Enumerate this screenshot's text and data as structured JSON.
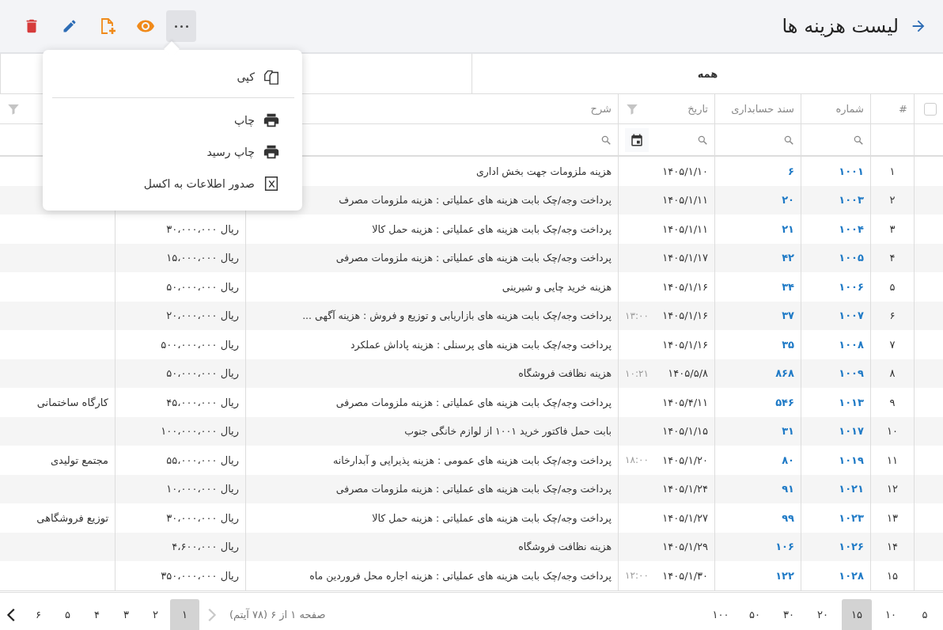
{
  "header": {
    "title": "لیست هزینه ها"
  },
  "toolbar": {
    "more_button": {
      "expanded": true
    }
  },
  "menu": {
    "items": [
      {
        "kind": "copy",
        "label": "کپی"
      },
      {
        "kind": "divider"
      },
      {
        "kind": "print",
        "label": "چاپ"
      },
      {
        "kind": "print",
        "label": "چاپ رسید"
      },
      {
        "kind": "excel",
        "label": "صدور اطلاعات به اکسل"
      }
    ]
  },
  "tabs": [
    {
      "label": "همه",
      "selected": true
    },
    {
      "selected": false
    }
  ],
  "table": {
    "columns": [
      {
        "kind": "checkbox",
        "checked": false,
        "search": false
      },
      {
        "kind": "text",
        "label": "#",
        "search": false
      },
      {
        "kind": "text",
        "label": "شماره",
        "search": true
      },
      {
        "kind": "text",
        "label": "سند حسابداری",
        "search": true
      },
      {
        "kind": "text",
        "label": "تاریخ",
        "filter": true,
        "search": true,
        "calendar": true
      },
      {
        "kind": "text",
        "label": "شرح",
        "search": true
      },
      {
        "kind": "text"
      },
      {
        "kind": "text",
        "filter": true
      }
    ],
    "rows": [
      {
        "index": "۱",
        "number": "۱۰۰۱",
        "voucher": "۶",
        "date": "۱۴۰۵/۱/۱۰",
        "description": "هزینه ملزومات جهت بخش اداری"
      },
      {
        "index": "۲",
        "number": "۱۰۰۳",
        "voucher": "۲۰",
        "date": "۱۴۰۵/۱/۱۱",
        "description": "پرداخت وجه/چک بابت هزینه های عملیاتی : هزینه ملزومات مصرف"
      },
      {
        "index": "۳",
        "number": "۱۰۰۴",
        "voucher": "۲۱",
        "date": "۱۴۰۵/۱/۱۱",
        "description": "پرداخت وجه/چک بابت هزینه های عملیاتی : هزینه حمل کالا",
        "amount": "ریال ۳۰،۰۰۰،۰۰۰"
      },
      {
        "index": "۴",
        "number": "۱۰۰۵",
        "voucher": "۴۲",
        "date": "۱۴۰۵/۱/۱۷",
        "description": "پرداخت وجه/چک بابت هزینه های عملیاتی : هزینه ملزومات مصرفی",
        "amount": "ریال ۱۵،۰۰۰،۰۰۰"
      },
      {
        "index": "۵",
        "number": "۱۰۰۶",
        "voucher": "۳۴",
        "date": "۱۴۰۵/۱/۱۶",
        "description": "هزینه خرید چایی و شیرینی",
        "amount": "ریال ۵۰،۰۰۰،۰۰۰"
      },
      {
        "index": "۶",
        "number": "۱۰۰۷",
        "voucher": "۳۷",
        "date": "۱۴۰۵/۱/۱۶",
        "time": "۱۳:۰۰",
        "description": "پرداخت وجه/چک بابت هزینه های بازاریابی و توزیع و فروش : هزینه آگهی ...",
        "amount": "ریال ۲۰،۰۰۰،۰۰۰"
      },
      {
        "index": "۷",
        "number": "۱۰۰۸",
        "voucher": "۳۵",
        "date": "۱۴۰۵/۱/۱۶",
        "description": "پرداخت وجه/چک بابت هزینه های پرسنلی : هزینه پاداش عملکرد",
        "amount": "ریال ۵۰۰،۰۰۰،۰۰۰"
      },
      {
        "index": "۸",
        "number": "۱۰۰۹",
        "voucher": "۸۶۸",
        "date": "۱۴۰۵/۵/۸",
        "time": "۱۰:۲۱",
        "description": "هزینه نظافت فروشگاه",
        "amount": "ریال ۵۰،۰۰۰،۰۰۰"
      },
      {
        "index": "۹",
        "number": "۱۰۱۳",
        "voucher": "۵۴۶",
        "date": "۱۴۰۵/۴/۱۱",
        "description": "پرداخت وجه/چک بابت هزینه های عملیاتی : هزینه ملزومات مصرفی",
        "amount": "ریال ۴۵،۰۰۰،۰۰۰",
        "column_8": "کارگاه ساختمانی"
      },
      {
        "index": "۱۰",
        "number": "۱۰۱۷",
        "voucher": "۳۱",
        "date": "۱۴۰۵/۱/۱۵",
        "description": "بابت حمل فاکتور خرید ۱۰۰۱ از لوازم خانگی جنوب",
        "amount": "ریال ۱۰۰،۰۰۰،۰۰۰"
      },
      {
        "index": "۱۱",
        "number": "۱۰۱۹",
        "voucher": "۸۰",
        "date": "۱۴۰۵/۱/۲۰",
        "time": "۱۸:۰۰",
        "description": "پرداخت وجه/چک بابت هزینه های عمومی : هزینه پذیرایی و آبدارخانه",
        "amount": "ریال ۵۵،۰۰۰،۰۰۰",
        "column_8": "مجتمع تولیدی"
      },
      {
        "index": "۱۲",
        "number": "۱۰۲۱",
        "voucher": "۹۱",
        "date": "۱۴۰۵/۱/۲۴",
        "description": "پرداخت وجه/چک بابت هزینه های عملیاتی : هزینه ملزومات مصرفی",
        "amount": "ریال ۱۰،۰۰۰،۰۰۰"
      },
      {
        "index": "۱۳",
        "number": "۱۰۲۳",
        "voucher": "۹۹",
        "date": "۱۴۰۵/۱/۲۷",
        "description": "پرداخت وجه/چک بابت هزینه های عملیاتی : هزینه حمل کالا",
        "amount": "ریال ۳۰،۰۰۰،۰۰۰",
        "column_8": "توزیع فروشگاهی"
      },
      {
        "index": "۱۴",
        "number": "۱۰۲۶",
        "voucher": "۱۰۶",
        "date": "۱۴۰۵/۱/۲۹",
        "description": "هزینه نظافت فروشگاه",
        "amount": "ریال ۴،۶۰۰،۰۰۰"
      },
      {
        "index": "۱۵",
        "number": "۱۰۲۸",
        "voucher": "۱۲۲",
        "date": "۱۴۰۵/۱/۳۰",
        "time": "۱۲:۰۰",
        "description": "پرداخت وجه/چک بابت هزینه های عملیاتی : هزینه اجاره محل فروردین ماه",
        "amount": "ریال ۳۵۰،۰۰۰،۰۰۰"
      }
    ]
  },
  "pager": {
    "page_sizes": [
      {
        "label": "۵",
        "selected": false
      },
      {
        "label": "۱۰",
        "selected": false
      },
      {
        "label": "۱۵",
        "selected": true
      },
      {
        "label": "۲۰",
        "selected": false
      },
      {
        "label": "۳۰",
        "selected": false
      },
      {
        "label": "۵۰",
        "selected": false
      },
      {
        "label": "۱۰۰",
        "selected": false
      }
    ],
    "info": "صفحه ۱ از ۶ (۷۸ آیتم)",
    "prev": {
      "disabled": true
    },
    "pages": [
      {
        "label": "۱",
        "selected": true
      },
      {
        "label": "۲",
        "selected": false
      },
      {
        "label": "۳",
        "selected": false
      },
      {
        "label": "۴",
        "selected": false
      },
      {
        "label": "۵",
        "selected": false
      },
      {
        "label": "۶",
        "selected": false
      }
    ],
    "next": {
      "disabled": false
    }
  }
}
